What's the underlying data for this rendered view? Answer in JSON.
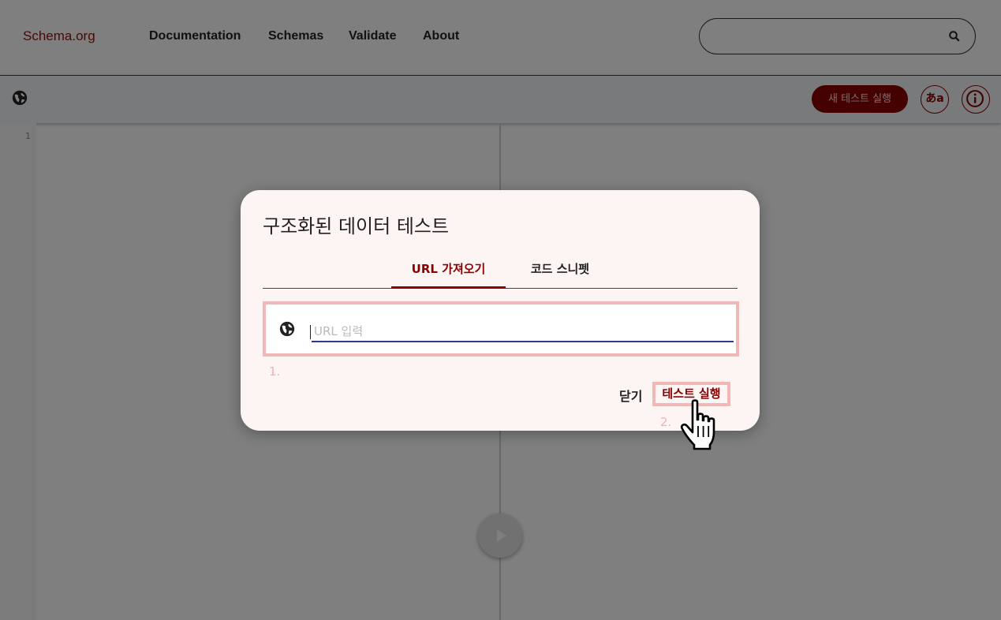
{
  "nav": {
    "logo": "Schema.org",
    "links": [
      "Documentation",
      "Schemas",
      "Validate",
      "About"
    ],
    "search_placeholder": ""
  },
  "toolbar": {
    "run_label": "새 테스트 실행",
    "lang_label": "あa"
  },
  "editor": {
    "line_number": "1"
  },
  "dialog": {
    "title": "구조화된 데이터 테스트",
    "tabs": [
      "URL 가져오기",
      "코드 스니펫"
    ],
    "active_tab": "URL 가져오기",
    "url_placeholder": "URL 입력",
    "url_value": "",
    "step1": "1.",
    "step2": "2.",
    "close_label": "닫기",
    "run_label": "테스트 실행"
  },
  "colors": {
    "brand": "#8a0000",
    "highlight": "#f2b8b8",
    "input_underline": "#2b3a8c"
  }
}
